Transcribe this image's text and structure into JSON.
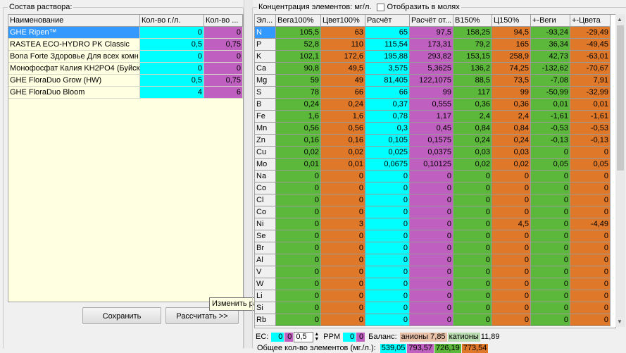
{
  "left_panel": {
    "title": "Состав раствора:",
    "columns": [
      "Наименование",
      "Кол-во г./л.",
      "Кол-во ..."
    ],
    "rows": [
      {
        "name": "GHE Ripen™",
        "q1": "0",
        "q2": "0",
        "selected": true
      },
      {
        "name": "RASTEA ECO-HYDRO PK Classic",
        "q1": "0,5",
        "q2": "0,75",
        "selected": false
      },
      {
        "name": "Bona Forte Здоровье Для всех комн",
        "q1": "0",
        "q2": "0",
        "selected": false
      },
      {
        "name": "Монофосфат Калия KH2PO4 (Буйскі",
        "q1": "0",
        "q2": "0",
        "selected": false
      },
      {
        "name": "GHE FloraDuo Grow (HW)",
        "q1": "0,5",
        "q2": "0,75",
        "selected": false
      },
      {
        "name": "GHE FloraDuo Bloom",
        "q1": "4",
        "q2": "6",
        "selected": false
      }
    ],
    "save_label": "Сохранить",
    "calc_label": "Рассчитать >>",
    "tooltip": "Изменить размер"
  },
  "right_panel": {
    "title": "Концентрация элементов: мг/л.",
    "checkbox_label": "Отобразить в молях",
    "columns": [
      "Эл...",
      "Вега100%",
      "Цвет100%",
      "Расчёт",
      "Расчёт от...",
      "В150%",
      "Ц150%",
      "+-Веги",
      "+-Цвета"
    ],
    "rows": [
      [
        "N",
        "105,5",
        "63",
        "65",
        "97,5",
        "158,25",
        "94,5",
        "-93,24",
        "-29,49"
      ],
      [
        "P",
        "52,8",
        "110",
        "115,54",
        "173,31",
        "79,2",
        "165",
        "36,34",
        "-49,45"
      ],
      [
        "K",
        "102,1",
        "172,6",
        "195,88",
        "293,82",
        "153,15",
        "258,9",
        "42,73",
        "-63,01"
      ],
      [
        "Ca",
        "90,8",
        "49,5",
        "3,575",
        "5,3625",
        "136,2",
        "74,25",
        "-132,62",
        "-70,67"
      ],
      [
        "Mg",
        "59",
        "49",
        "81,405",
        "122,1075",
        "88,5",
        "73,5",
        "-7,08",
        "7,91"
      ],
      [
        "S",
        "78",
        "66",
        "66",
        "99",
        "117",
        "99",
        "-50,99",
        "-32,99"
      ],
      [
        "B",
        "0,24",
        "0,24",
        "0,37",
        "0,555",
        "0,36",
        "0,36",
        "0,01",
        "0,01"
      ],
      [
        "Fe",
        "1,6",
        "1,6",
        "0,78",
        "1,17",
        "2,4",
        "2,4",
        "-1,61",
        "-1,61"
      ],
      [
        "Mn",
        "0,56",
        "0,56",
        "0,3",
        "0,45",
        "0,84",
        "0,84",
        "-0,53",
        "-0,53"
      ],
      [
        "Zn",
        "0,16",
        "0,16",
        "0,105",
        "0,1575",
        "0,24",
        "0,24",
        "-0,13",
        "-0,13"
      ],
      [
        "Cu",
        "0,02",
        "0,02",
        "0,025",
        "0,0375",
        "0,03",
        "0,03",
        "0",
        "0"
      ],
      [
        "Mo",
        "0,01",
        "0,01",
        "0,0675",
        "0,10125",
        "0,02",
        "0,02",
        "0,05",
        "0,05"
      ],
      [
        "Na",
        "0",
        "0",
        "0",
        "0",
        "0",
        "0",
        "0",
        "0"
      ],
      [
        "Co",
        "0",
        "0",
        "0",
        "0",
        "0",
        "0",
        "0",
        "0"
      ],
      [
        "Cl",
        "0",
        "0",
        "0",
        "0",
        "0",
        "0",
        "0",
        "0"
      ],
      [
        "Co",
        "0",
        "0",
        "0",
        "0",
        "0",
        "0",
        "0",
        "0"
      ],
      [
        "Ni",
        "0",
        "3",
        "0",
        "0",
        "0",
        "4,5",
        "0",
        "-4,49"
      ],
      [
        "Se",
        "0",
        "0",
        "0",
        "0",
        "0",
        "0",
        "0",
        "0"
      ],
      [
        "Br",
        "0",
        "0",
        "0",
        "0",
        "0",
        "0",
        "0",
        "0"
      ],
      [
        "Al",
        "0",
        "0",
        "0",
        "0",
        "0",
        "0",
        "0",
        "0"
      ],
      [
        "V",
        "0",
        "0",
        "0",
        "0",
        "0",
        "0",
        "0",
        "0"
      ],
      [
        "W",
        "0",
        "0",
        "0",
        "0",
        "0",
        "0",
        "0",
        "0"
      ],
      [
        "Li",
        "0",
        "0",
        "0",
        "0",
        "0",
        "0",
        "0",
        "0"
      ],
      [
        "Si",
        "0",
        "0",
        "0",
        "0",
        "0",
        "0",
        "0",
        "0"
      ],
      [
        "Rb",
        "0",
        "0",
        "0",
        "0",
        "0",
        "0",
        "0",
        "0"
      ]
    ],
    "column_colors": [
      "#f0f0f0",
      "#5cb83a",
      "#e0782a",
      "#00ffff",
      "#bf5fbf",
      "#5cb83a",
      "#e0782a",
      "#5cb83a",
      "#e0782a"
    ]
  },
  "footer": {
    "ec_label": "EC:",
    "ec_cyan": "0",
    "ec_purple": "0",
    "ec_spin": "0,5",
    "ppm_label": "PPM",
    "ppm_cyan": "0",
    "ppm_purple": "0",
    "balance_label": "Баланс:",
    "anions_label": "анионы",
    "anions_value": "7,85",
    "cations_label": "катионы",
    "cations_value": "11,89",
    "total_label": "Общее кол-во элементов (мг./л.):",
    "total_values": [
      "539,05",
      "793,57",
      "726,19",
      "773,54"
    ]
  },
  "colors": {
    "green": "#5cb83a",
    "orange": "#e0782a",
    "cyan": "#00ffff",
    "purple": "#bf5fbf",
    "selection": "#3399ff",
    "left_grid_bg": "#ffffe1"
  }
}
